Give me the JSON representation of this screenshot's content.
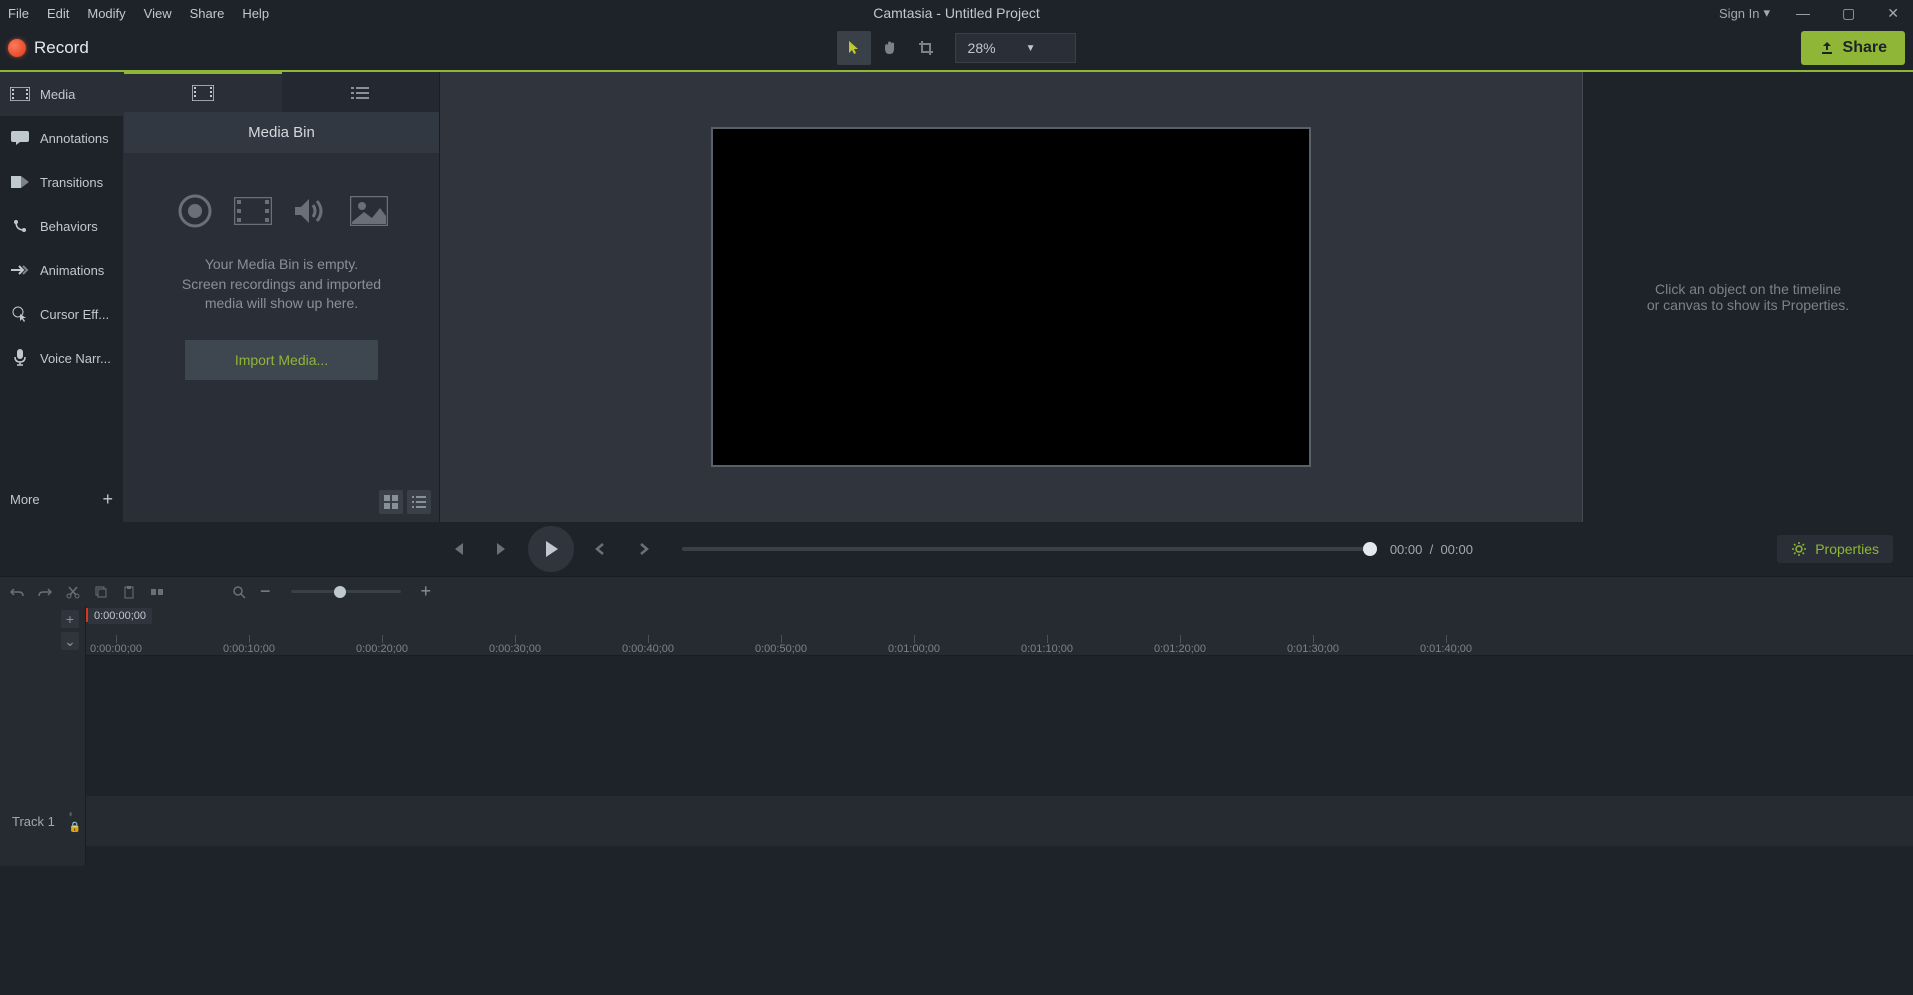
{
  "menubar": {
    "items": [
      "File",
      "Edit",
      "Modify",
      "View",
      "Share",
      "Help"
    ],
    "title": "Camtasia - Untitled Project",
    "signin": "Sign In"
  },
  "toolbar": {
    "record": "Record",
    "zoom": "28%",
    "share": "Share"
  },
  "sidebar": {
    "items": [
      {
        "label": "Media"
      },
      {
        "label": "Annotations"
      },
      {
        "label": "Transitions"
      },
      {
        "label": "Behaviors"
      },
      {
        "label": "Animations"
      },
      {
        "label": "Cursor Eff..."
      },
      {
        "label": "Voice Narr..."
      }
    ],
    "more": "More"
  },
  "media": {
    "title": "Media Bin",
    "empty_line1": "Your Media Bin is empty.",
    "empty_line2": "Screen recordings and imported",
    "empty_line3": "media will show up here.",
    "import_btn": "Import Media..."
  },
  "props_panel": {
    "hint_line1": "Click an object on the timeline",
    "hint_line2": "or canvas to show its Properties."
  },
  "playback": {
    "current": "00:00",
    "sep": "/",
    "total": "00:00",
    "props_btn": "Properties"
  },
  "timeline": {
    "playhead_time": "0:00:00;00",
    "track1": "Track 1",
    "ticks": [
      "0:00:00;00",
      "0:00:10;00",
      "0:00:20;00",
      "0:00:30;00",
      "0:00:40;00",
      "0:00:50;00",
      "0:01:00;00",
      "0:01:10;00",
      "0:01:20;00",
      "0:01:30;00",
      "0:01:40;00"
    ]
  }
}
